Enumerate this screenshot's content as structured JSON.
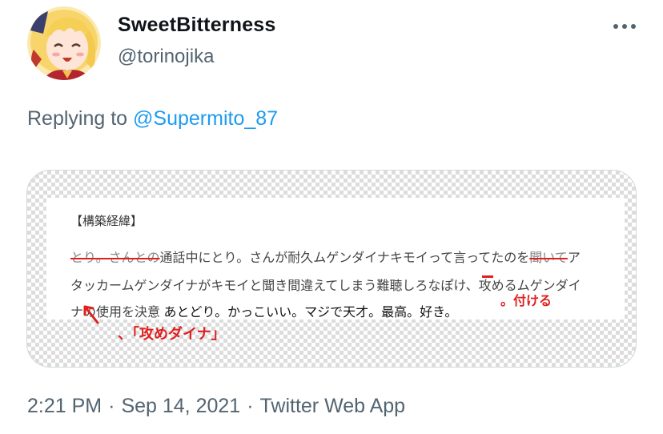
{
  "author": {
    "display_name": "SweetBitterness",
    "handle": "@torinojika",
    "avatar_icon": "anime-girl-avatar"
  },
  "menu": {
    "more_icon": "more-horizontal-icon"
  },
  "reply": {
    "prefix": "Replying to ",
    "mention": "@Supermito_87"
  },
  "media": {
    "heading": "【構築経緯】",
    "line1": {
      "strike_start": "とり。さんとの",
      "text": "通話中にとり。さんが耐久ムゲンダイナキモイって言ってたのを",
      "strike_end": "聞いて",
      "tail": "ア"
    },
    "line2": {
      "text": "タッカームゲンダイナがキモイと聞き間違えてしまう難聴しろなぽけ、攻めるムゲンダイ"
    },
    "line3": {
      "text": "ナの使用を決意",
      "text_dark": " あとどり。かっこいい。マジで天才。最高。好き。"
    },
    "annotation_add": "。付ける",
    "annotation_insert": "、「攻めダイナ」"
  },
  "footer": {
    "time": "2:21 PM",
    "date": "Sep 14, 2021",
    "source": "Twitter Web App",
    "separator": "·"
  },
  "colors": {
    "accent": "#1d9bf0",
    "secondary_text": "#536471",
    "annotation_red": "#e02020"
  }
}
